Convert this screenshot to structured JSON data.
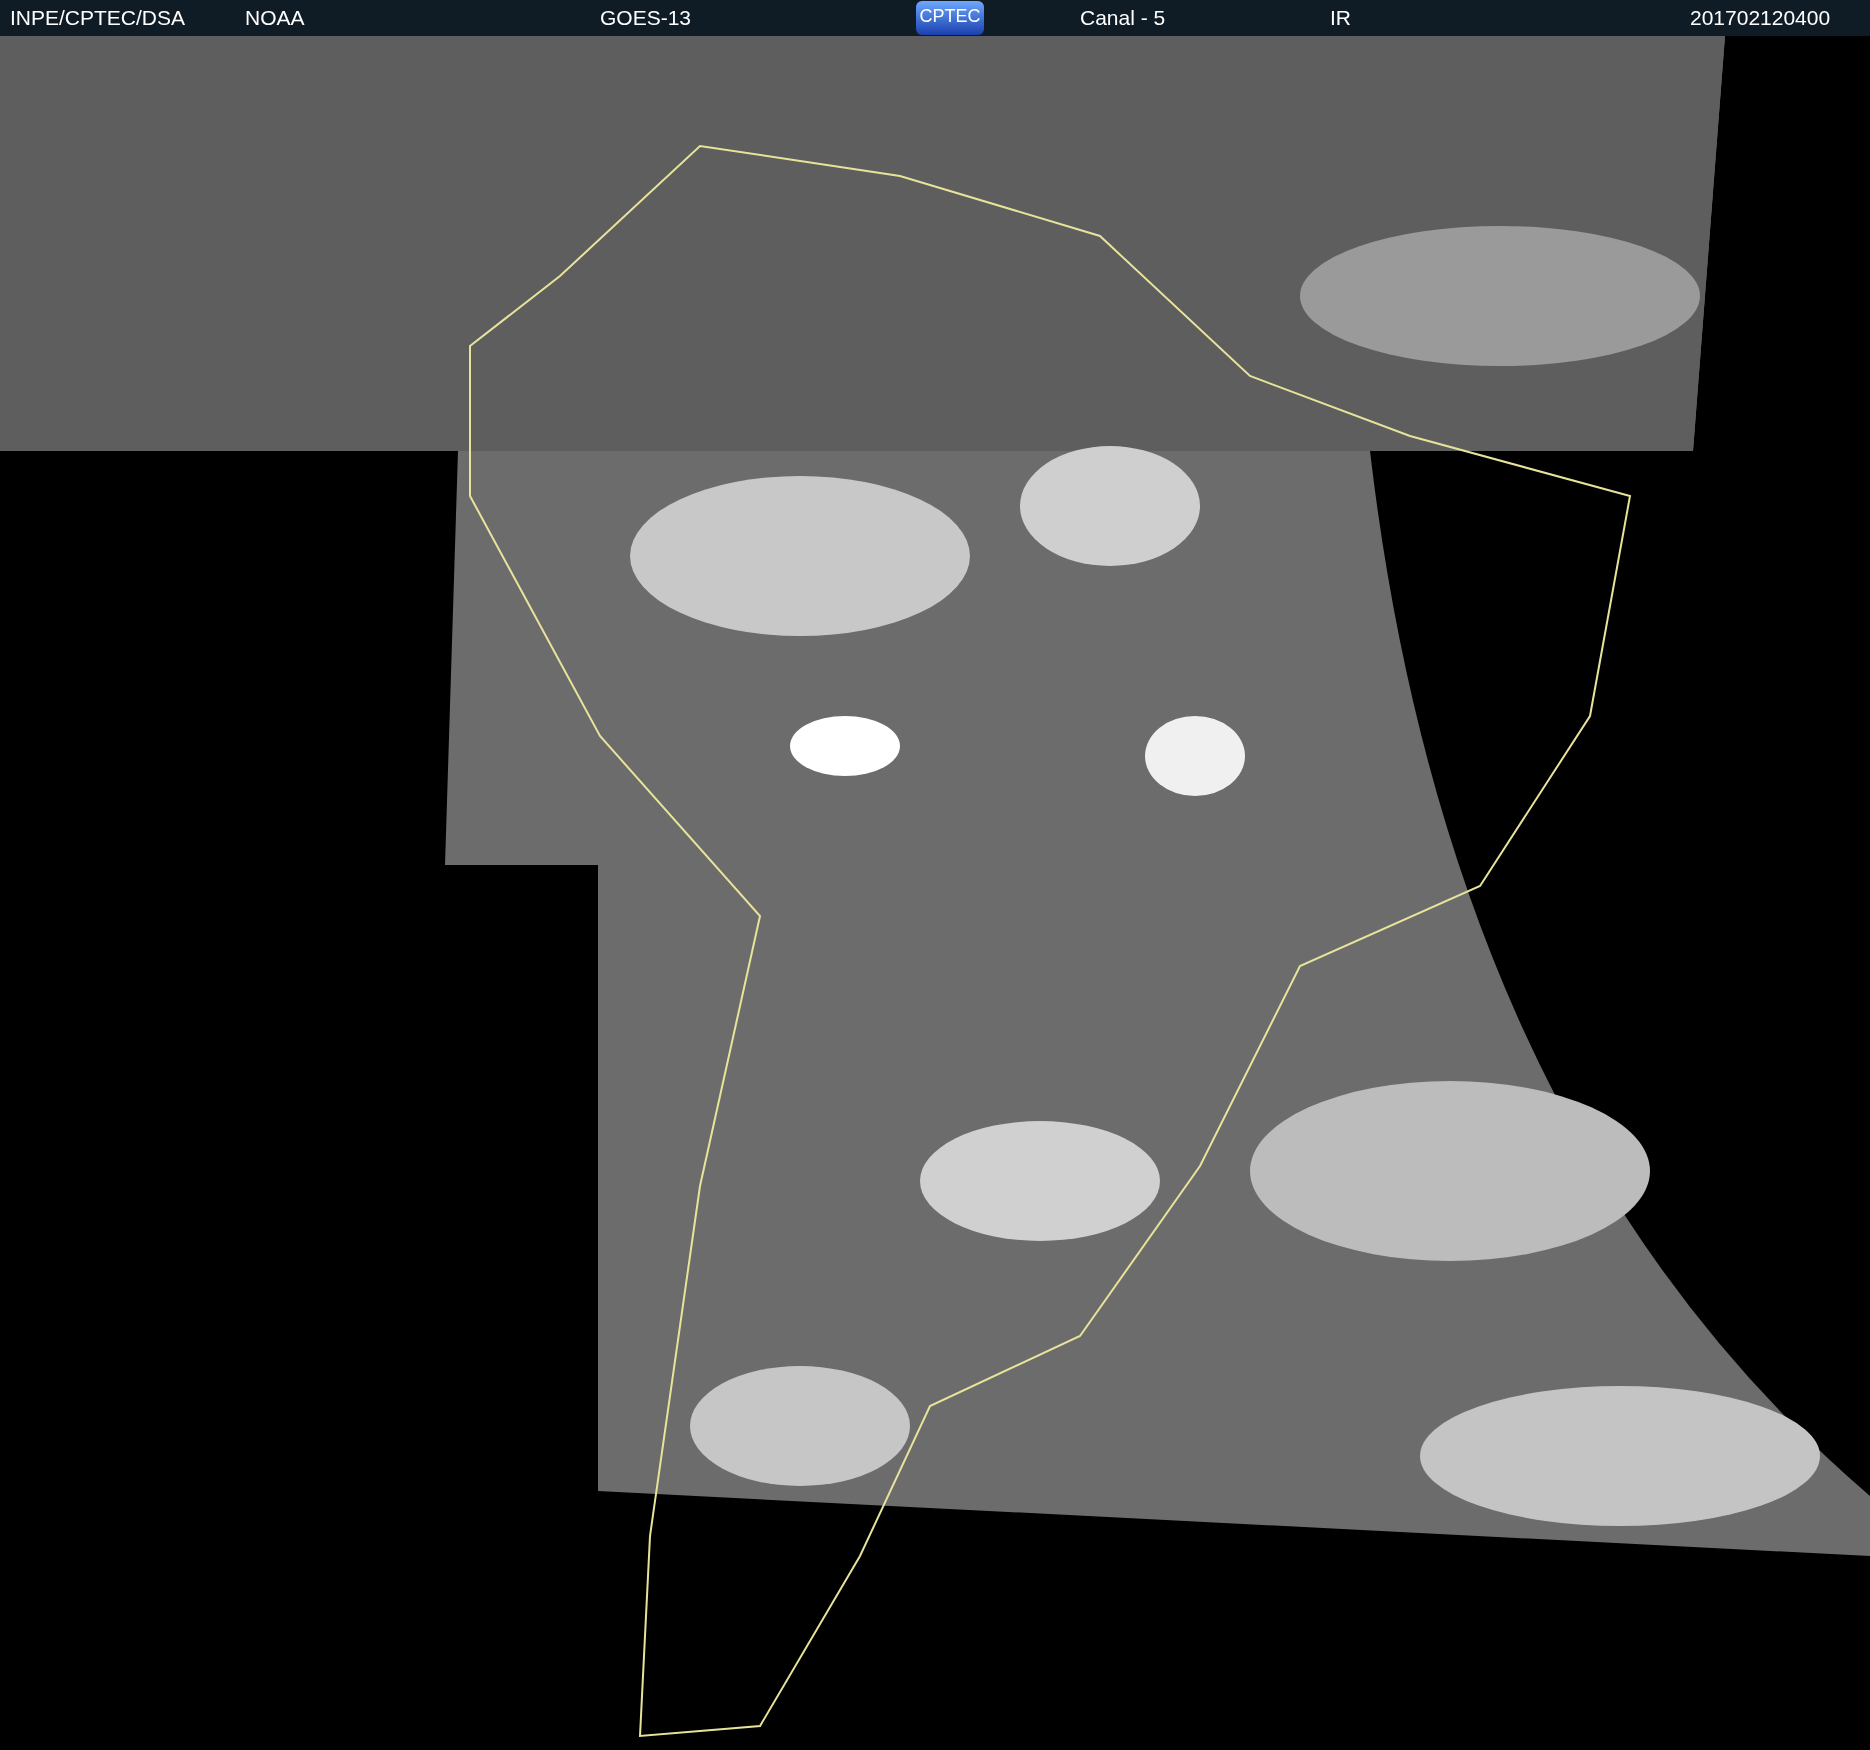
{
  "header": {
    "source": "INPE/CPTEC/DSA",
    "agency": "NOAA",
    "satellite": "GOES-13",
    "logo": "CPTEC",
    "channel": "Canal - 5",
    "band": "IR",
    "timestamp": "201702120400"
  }
}
